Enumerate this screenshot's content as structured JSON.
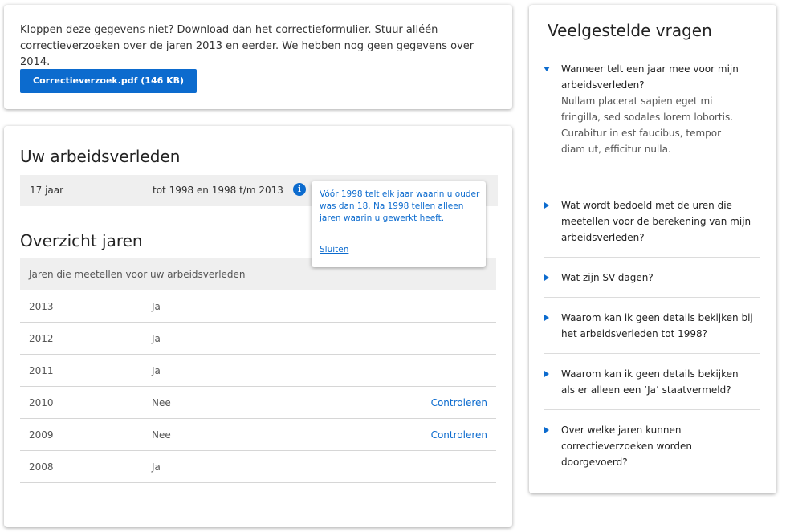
{
  "download": {
    "intro_text": "Kloppen deze gegevens niet? Download dan het correctieformulier. Stuur alléén correctieverzoeken over de jaren 2013 en eerder. We hebben nog geen gegevens over 2014.",
    "button_label": "Correctieverzoek.pdf (146 KB)"
  },
  "arbeidsverleden": {
    "title": "Uw arbeidsverleden",
    "years": "17 jaar",
    "period": "tot 1998 en 1998 t/m 2013",
    "info_icon": "info-icon",
    "tooltip": {
      "text": "Vóór 1998 telt elk jaar waarin u ouder was dan 18. Na 1998 tellen alleen jaren waarin u gewerkt heeft.",
      "close_label": "Sluiten"
    }
  },
  "overzicht": {
    "title": "Overzicht jaren",
    "header": "Jaren die meetellen voor uw arbeidsverleden",
    "rows": [
      {
        "year": "2013",
        "counts": "Ja",
        "action": ""
      },
      {
        "year": "2012",
        "counts": "Ja",
        "action": ""
      },
      {
        "year": "2011",
        "counts": "Ja",
        "action": ""
      },
      {
        "year": "2010",
        "counts": "Nee",
        "action": "Controleren"
      },
      {
        "year": "2009",
        "counts": "Nee",
        "action": "Controleren"
      },
      {
        "year": "2008",
        "counts": "Ja",
        "action": ""
      }
    ]
  },
  "faq": {
    "title": "Veelgestelde vragen",
    "items": [
      {
        "question": "Wanneer telt een jaar mee voor mijn arbeidsverleden?",
        "answer": "Nullam placerat sapien eget mi fringilla, sed sodales lorem lobortis. Curabitur in est faucibus, tempor diam ut, efficitur nulla.",
        "expanded": true
      },
      {
        "question": "Wat wordt bedoeld met de uren die meetellen voor de berekening van mijn arbeidsverleden?",
        "expanded": false
      },
      {
        "question": "Wat zijn SV-dagen?",
        "expanded": false
      },
      {
        "question": "Waarom kan ik geen details bekijken bij het arbeidsverleden tot 1998?",
        "expanded": false
      },
      {
        "question": "Waarom kan ik geen details bekijken als er alleen een ‘Ja’ staatvermeld?",
        "expanded": false
      },
      {
        "question": "Over welke jaren kunnen correctieverzoeken worden doorgevoerd?",
        "expanded": false
      }
    ]
  },
  "colors": {
    "accent": "#0c6bce",
    "row_background": "#efefef"
  }
}
